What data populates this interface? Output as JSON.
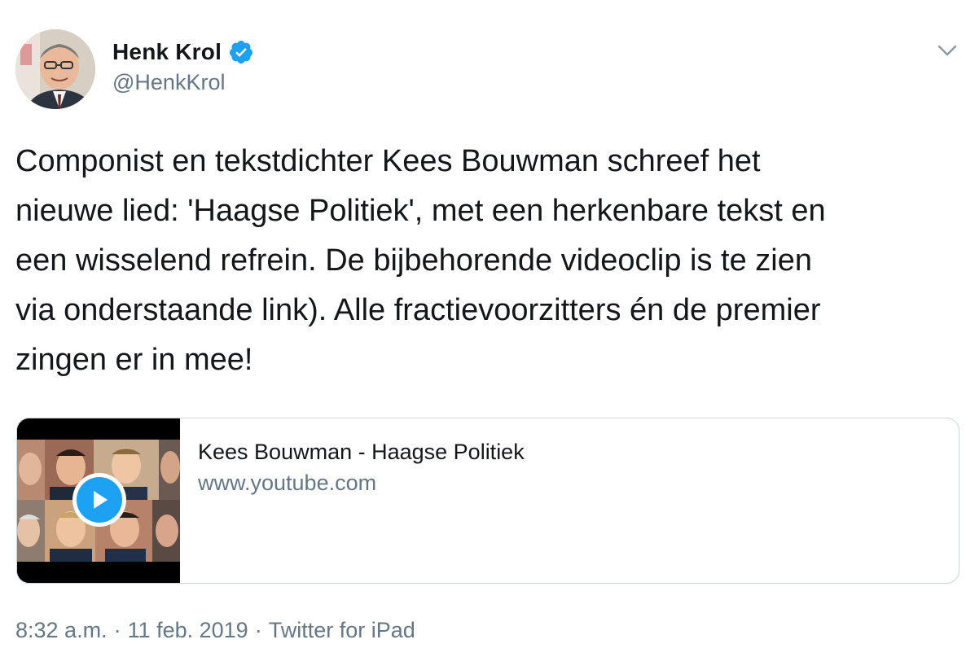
{
  "author": {
    "display_name": "Henk Krol",
    "handle": "@HenkKrol",
    "verified": true
  },
  "tweet": {
    "text": "Componist en tekstdichter Kees Bouwman schreef het\nnieuwe lied: 'Haagse Politiek', met een herkenbare tekst en\neen wisselend refrein. De bijbehorende videoclip is te zien\nvia onderstaande link). Alle fractievoorzitters én de premier\nzingen er in mee!"
  },
  "card": {
    "title": "Kees Bouwman - Haagse Politiek",
    "domain": "www.youtube.com",
    "thumb_icon": "play-icon"
  },
  "meta": {
    "time": "8:32 a.m.",
    "separator": "·",
    "date": "11 feb. 2019",
    "source": "Twitter for iPad"
  },
  "colors": {
    "accent": "#1da1f2",
    "text": "#14171a",
    "secondary": "#657786",
    "border": "#ccd6dd"
  },
  "icons": {
    "verified": "verified-badge-icon",
    "more": "chevron-down-icon",
    "play": "play-icon"
  }
}
